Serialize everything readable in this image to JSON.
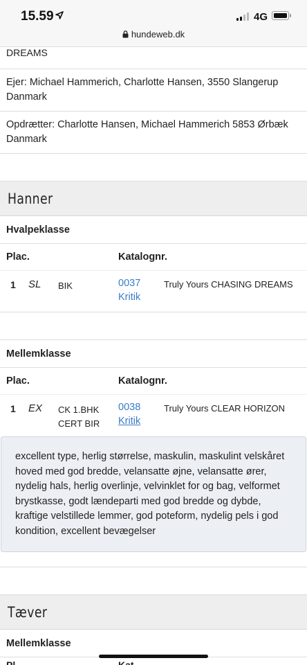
{
  "status_bar": {
    "time": "15.59",
    "network": "4G",
    "url": "hundeweb.dk",
    "icons": [
      "location-arrow-icon",
      "signal-icon",
      "battery-icon",
      "lock-icon"
    ]
  },
  "top_fragment": "DREAMS",
  "owner": "Ejer: Michael Hammerich, Charlotte Hansen, 3550 Slangerup Danmark",
  "breeder": "Opdrætter: Charlotte Hansen, Michael Hammerich 5853 Ørbæk Danmark",
  "sections": [
    {
      "title": "Hanner",
      "classes": [
        {
          "name": "Hvalpeklasse",
          "col_plac": "Plac.",
          "col_katalog": "Katalognr.",
          "entry": {
            "placement": "1",
            "grade": "SL",
            "award_line1": "BIK",
            "award_line2": "",
            "catalog_no": "0037",
            "kritik": "Kritik",
            "dog_name": "Truly Yours CHASING DREAMS"
          }
        },
        {
          "name": "Mellemklasse",
          "col_plac": "Plac.",
          "col_katalog": "Katalognr.",
          "entry": {
            "placement": "1",
            "grade": "EX",
            "award_line1": "CK 1.BHK",
            "award_line2": "CERT BIR",
            "catalog_no": "0038",
            "kritik": "Kritik",
            "dog_name": "Truly Yours CLEAR HORIZON"
          },
          "critique": "excellent type, herlig størrelse, maskulin, maskulint velskåret hoved med god bredde, velansatte øjne, velansatte ører, nydelig hals, herlig overlinje, velvinklet for og bag, velformet brystkasse, godt lændeparti med god bredde og dybde, kraftige velstillede lemmer, god poteform, nydelig pels i god kondition, excellent bevægelser"
        }
      ]
    },
    {
      "title": "Tæver",
      "classes": [
        {
          "name": "Mellemklasse",
          "col_plac": "Pl",
          "col_katalog": "Kat"
        }
      ]
    }
  ],
  "colors": {
    "link": "#3a7bc8",
    "header_bg": "#eeeeee",
    "critique_bg": "#eceff4"
  }
}
